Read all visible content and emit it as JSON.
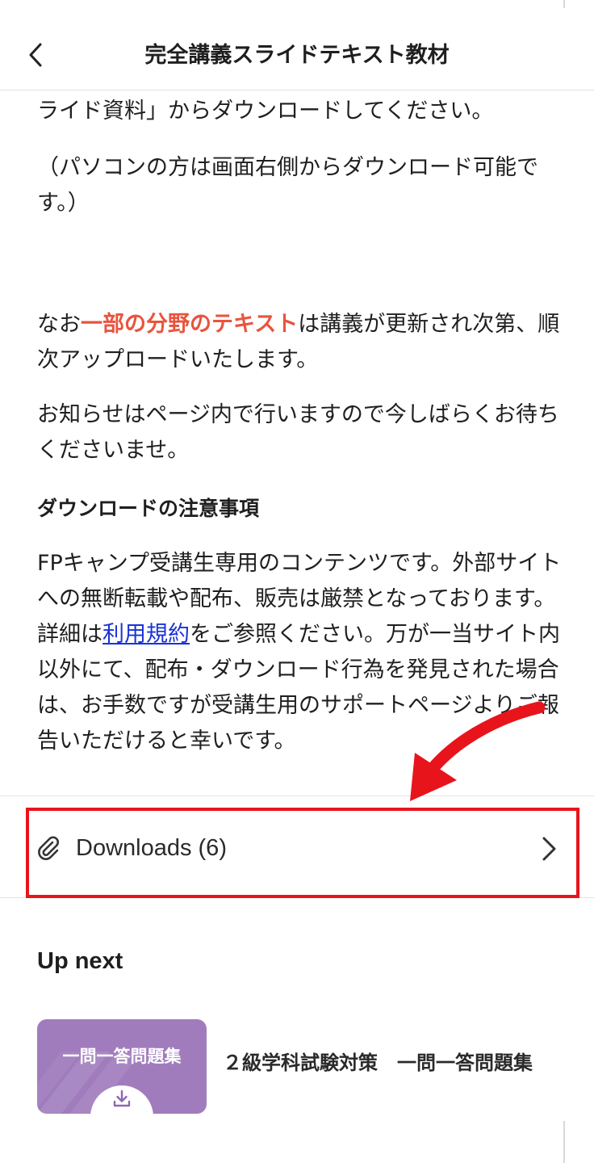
{
  "header": {
    "title": "完全講義スライドテキスト教材"
  },
  "content": {
    "p1": "ライド資料」からダウンロードしてください。",
    "p2": "（パソコンの方は画面右側からダウンロード可能です。）",
    "p3_pre": "なお",
    "p3_highlight": "一部の分野のテキスト",
    "p3_post": "は講義が更新され次第、順次アップロードいたします。",
    "p4": "お知らせはページ内で行いますので今しばらくお待ちくださいませ。",
    "heading": "ダウンロードの注意事項",
    "p5_pre": "FPキャンプ受講生専用のコンテンツです。外部サイトへの無断転載や配布、販売は厳禁となっております。詳細は",
    "p5_link": "利用規約",
    "p5_post": "をご参照ください。万が一当サイト内以外にて、配布・ダウンロード行為を発見された場合は、お手数ですが受講生用のサポートページよりご報告いただけると幸いです。"
  },
  "downloads": {
    "label": "Downloads (6)"
  },
  "up_next": {
    "title": "Up next",
    "item": {
      "thumb_text": "一問一答問題集",
      "title": "２級学科試験対策　一問一答問題集"
    }
  },
  "colors": {
    "highlight_text": "#e9543e",
    "link": "#1a33d6",
    "annotation_red": "#e8141c",
    "thumbnail_bg": "#a07cbd"
  },
  "icons": {
    "back": "chevron-left-icon",
    "attachment": "paperclip-icon",
    "row_chevron": "chevron-right-icon",
    "download": "download-icon"
  }
}
